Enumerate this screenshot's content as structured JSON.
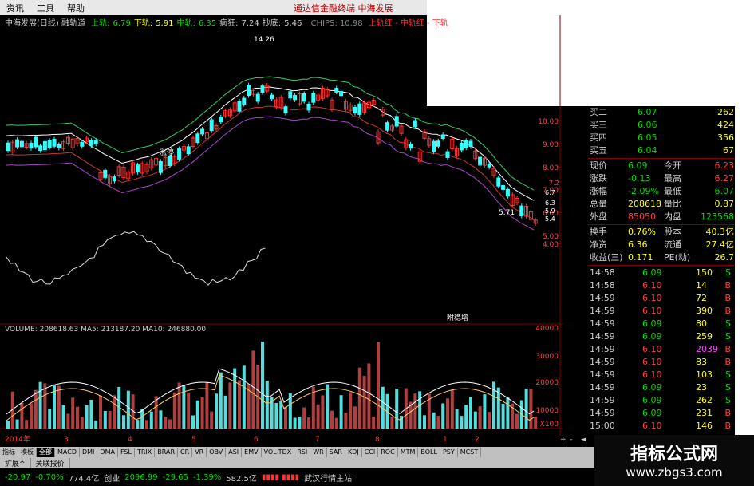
{
  "menu": {
    "items": [
      "资讯",
      "工具",
      "帮助"
    ],
    "title": "通达信金融终端   中海发展"
  },
  "infobar": {
    "name": "中海发展(日线) 融轨道",
    "items": [
      {
        "label": "上轨:",
        "value": "6.79",
        "color": "#00dd00"
      },
      {
        "label": "下轨:",
        "value": "5.91",
        "color": "#ffff00"
      },
      {
        "label": "中轨:",
        "value": "6.35",
        "color": "#00dd00"
      },
      {
        "label": "疯狂:",
        "value": "7.24",
        "color": "#cccccc"
      },
      {
        "label": "抄底:",
        "value": "5.46",
        "color": "#cccccc"
      }
    ],
    "chips": "CHIPS: 10.98",
    "chips_extra": "上轨红 - 中轨红 - 下轨"
  },
  "price_axis": [
    "10.00",
    "9.00",
    "8.00",
    "7.00",
    "6.00",
    "5.00",
    "4.00"
  ],
  "volume_axis": [
    "40000",
    "30000",
    "20000",
    "10000",
    "X100"
  ],
  "annotations": {
    "high": "14.26",
    "low": "5.71",
    "zt": "涨停",
    "label_mid": "附稳增",
    "right_vals": [
      "6.7",
      "6.3",
      "5.9",
      "5.4"
    ],
    "r_marker": "7.2"
  },
  "volume_info": "VOLUME: 208618.63  MA5: 213187.20  MA10: 246880.00",
  "time_axis": [
    "2014年",
    "3",
    "4",
    "5",
    "6",
    "7",
    "8",
    "1",
    "2"
  ],
  "timeaxis_right": "日线",
  "quote": {
    "book": [
      {
        "label": "买二",
        "price": "6.07",
        "vol": "262"
      },
      {
        "label": "买三",
        "price": "6.06",
        "vol": "424"
      },
      {
        "label": "买四",
        "price": "6.05",
        "vol": "356"
      },
      {
        "label": "买五",
        "price": "6.04",
        "vol": "67"
      }
    ],
    "stats": [
      {
        "l1": "现价",
        "v1": "6.09",
        "c1": "#00dd00",
        "l2": "今开",
        "v2": "6.23",
        "c2": "#ff4040"
      },
      {
        "l1": "涨跌",
        "v1": "-0.13",
        "c1": "#00dd00",
        "l2": "最高",
        "v2": "6.27",
        "c2": "#ff4040"
      },
      {
        "l1": "涨幅",
        "v1": "-2.09%",
        "c1": "#00dd00",
        "l2": "最低",
        "v2": "6.07",
        "c2": "#00dd00"
      },
      {
        "l1": "总量",
        "v1": "208618",
        "c1": "#ffff00",
        "l2": "量比",
        "v2": "0.87",
        "c2": "#ffff00"
      },
      {
        "l1": "外盘",
        "v1": "85050",
        "c1": "#ff4040",
        "l2": "内盘",
        "v2": "123568",
        "c2": "#00dd00"
      },
      {
        "l1": "换手",
        "v1": "0.76%",
        "c1": "#ffff00",
        "l2": "股本",
        "v2": "40.3亿",
        "c2": "#ffff00"
      },
      {
        "l1": "净资",
        "v1": "6.36",
        "c1": "#ffff00",
        "l2": "流通",
        "v2": "27.4亿",
        "c2": "#ffff00"
      },
      {
        "l1": "收益(三)",
        "v1": "0.171",
        "c1": "#ffff00",
        "l2": "PE(动)",
        "v2": "26.7",
        "c2": "#ffff00"
      }
    ],
    "ticks": [
      {
        "t": "14:58",
        "p": "6.09",
        "v": "150",
        "s": "S"
      },
      {
        "t": "14:58",
        "p": "6.10",
        "v": "14",
        "s": "B"
      },
      {
        "t": "14:59",
        "p": "6.10",
        "v": "72",
        "s": "B"
      },
      {
        "t": "14:59",
        "p": "6.10",
        "v": "390",
        "s": "B"
      },
      {
        "t": "14:59",
        "p": "6.09",
        "v": "80",
        "s": "S"
      },
      {
        "t": "14:59",
        "p": "6.09",
        "v": "259",
        "s": "S"
      },
      {
        "t": "14:59",
        "p": "6.10",
        "v": "2039",
        "s": "B"
      },
      {
        "t": "14:59",
        "p": "6.10",
        "v": "83",
        "s": "B"
      },
      {
        "t": "14:59",
        "p": "6.10",
        "v": "103",
        "s": "S"
      },
      {
        "t": "14:59",
        "p": "6.09",
        "v": "23",
        "s": "S"
      },
      {
        "t": "14:59",
        "p": "6.09",
        "v": "262",
        "s": "S"
      },
      {
        "t": "14:59",
        "p": "6.09",
        "v": "231",
        "s": "B"
      },
      {
        "t": "15:00",
        "p": "6.10",
        "v": "146",
        "s": "B"
      },
      {
        "t": "15:00",
        "p": "6.09",
        "v": "75",
        "s": "B"
      }
    ]
  },
  "tabs": [
    "指标",
    "模板",
    "全部",
    "MACD",
    "DMI",
    "DMA",
    "FSL",
    "TRIX",
    "BRAR",
    "CR",
    "VR",
    "OBV",
    "ASI",
    "EMV",
    "VOL-TDX",
    "RSI",
    "WR",
    "SAR",
    "KDJ",
    "CCI",
    "ROC",
    "MTM",
    "BOLL",
    "PSY",
    "MCST"
  ],
  "row2": [
    "扩展^",
    "关联报价"
  ],
  "status": {
    "a": "-20.97",
    "b": "-0.70%",
    "c": "774.4亿",
    "d": "创业",
    "e": "2096.99",
    "f": "-29.65",
    "g": "-1.39%",
    "h": "582.5亿",
    "i": "武汉行情主站"
  },
  "watermark": {
    "line1": "指标公式网",
    "line2": "www.zbgs3.com"
  },
  "scrollctl": [
    "+",
    "-",
    "◄"
  ],
  "colors": {
    "up": "#ff3333",
    "down": "#33ffff",
    "ma": "#ffffff",
    "band_green": "#33cc66",
    "band_red": "#cc3333",
    "band_purple": "#aa44cc"
  }
}
